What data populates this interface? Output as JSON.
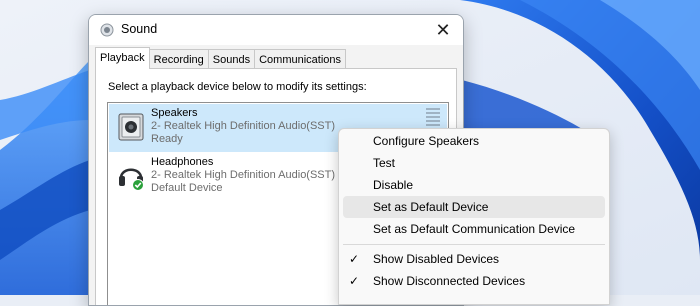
{
  "window": {
    "title": "Sound",
    "close_icon": "close-icon",
    "tabs": [
      {
        "label": "Playback",
        "active": true
      },
      {
        "label": "Recording",
        "active": false
      },
      {
        "label": "Sounds",
        "active": false
      },
      {
        "label": "Communications",
        "active": false
      }
    ],
    "instruction": "Select a playback device below to modify its settings:",
    "devices": [
      {
        "name": "Speakers",
        "description": "2- Realtek High Definition Audio(SST)",
        "status": "Ready",
        "icon": "speaker-icon",
        "selected": true
      },
      {
        "name": "Headphones",
        "description": "2- Realtek High Definition Audio(SST)",
        "status": "Default Device",
        "icon": "headphones-icon",
        "default_badge_icon": "green-check-icon",
        "selected": false
      }
    ]
  },
  "context_menu": {
    "items": [
      {
        "label": "Configure Speakers",
        "checked": false
      },
      {
        "label": "Test",
        "checked": false
      },
      {
        "label": "Disable",
        "checked": false
      },
      {
        "label": "Set as Default Device",
        "checked": false,
        "hover": true
      },
      {
        "label": "Set as Default Communication Device",
        "checked": false
      },
      {
        "label": "Show Disabled Devices",
        "checked": true
      },
      {
        "label": "Show Disconnected Devices",
        "checked": true
      }
    ],
    "check_glyph": "✓"
  },
  "colors": {
    "selection": "#cde8fb",
    "menu_hover": "#e7e7e7",
    "wallpaper_blue": "#1f5ed6",
    "default_badge": "#2aa13b"
  }
}
